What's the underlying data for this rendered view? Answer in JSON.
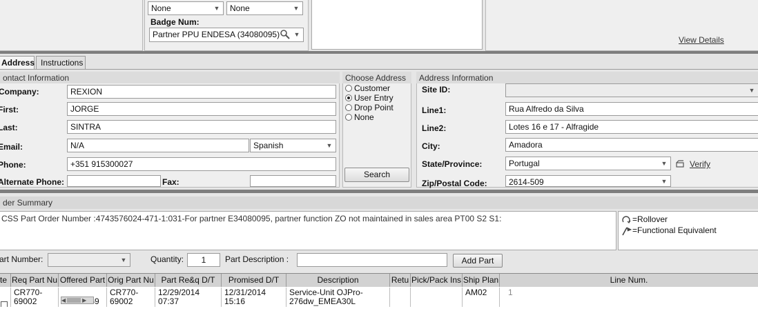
{
  "top": {
    "combo1_value": "None",
    "combo2_value": "None",
    "badge_label": "Badge Num:",
    "badge_value": "Partner PPU ENDESA (34080095)",
    "view_details": "View Details"
  },
  "tabs": [
    {
      "label": "Address"
    },
    {
      "label": "Instructions"
    }
  ],
  "contact": {
    "section_title": "ontact Information",
    "company_label": "Company:",
    "company_value": "REXION",
    "first_label": "First:",
    "first_value": "JORGE",
    "last_label": "Last:",
    "last_value": "SINTRA",
    "email_label": "Email:",
    "email_value": "N/A",
    "language_value": "Spanish",
    "phone_label": "Phone:",
    "phone_value": "+351 915300027",
    "alt_phone_label": "Alternate Phone:",
    "alt_phone_value": "",
    "fax_label": "Fax:",
    "fax_value": ""
  },
  "choose_address": {
    "title": "Choose Address",
    "options": [
      {
        "label": "Customer",
        "selected": false
      },
      {
        "label": "User Entry",
        "selected": true
      },
      {
        "label": "Drop Point",
        "selected": false
      },
      {
        "label": "None",
        "selected": false
      }
    ],
    "search_label": "Search"
  },
  "address": {
    "section_title": "Address Information",
    "site_label": "Site ID:",
    "site_value": "",
    "line1_label": "Line1:",
    "line1_value": "Rua Alfredo da Silva",
    "line2_label": "Line2:",
    "line2_value": "Lotes 16 e 17 - Alfragide",
    "city_label": "City:",
    "city_value": "Amadora",
    "state_label": "State/Province:",
    "state_value": "Portugal",
    "verify_label": "Verify",
    "zip_label": "Zip/Postal Code:",
    "zip_value": "2614-509"
  },
  "order": {
    "section_title": "der Summary",
    "message": "CSS Part Order Number :4743576024-471-1:031-For partner E34080095, partner function ZO not maintained in sales area PT00 S2 S1:",
    "legend_rollover": "=Rollover",
    "legend_functional": "=Functional Equivalent",
    "part_number_label": "art Number:",
    "part_number_value": "",
    "quantity_label": "Quantity:",
    "quantity_value": "1",
    "part_desc_label": "Part Description :",
    "part_desc_value": "",
    "add_part_label": "Add Part"
  },
  "grid": {
    "columns": [
      "te",
      "Req Part Nu",
      "Offered Part",
      "Orig Part Nu",
      "Part Re&q D/T",
      "Promised D/T",
      "Description",
      "Retu",
      "Pick/Pack Ins",
      "Ship Plan",
      "Line Num."
    ],
    "rows": [
      {
        "req_part": "CR770-\n69002",
        "offered_part": "CR770-69",
        "orig_part": "CR770-\n69002",
        "part_req_dt": "12/29/2014\n07:37",
        "promised_dt": "12/31/2014\n15:16",
        "description": "Service-Unit OJPro-\n276dw_EMEA30L",
        "return": "",
        "pick_pack": "",
        "ship_plan": "AM02",
        "line_num": "1"
      }
    ]
  }
}
